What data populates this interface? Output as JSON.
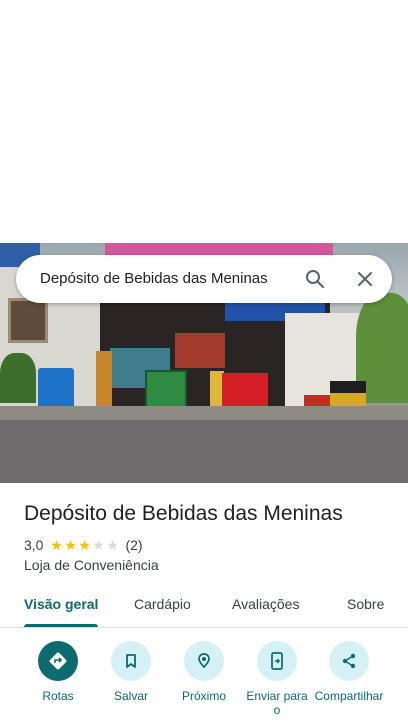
{
  "search": {
    "query": "Depósito de Bebidas das Meninas"
  },
  "place": {
    "title": "Depósito de Bebidas das Meninas",
    "rating": "3,0",
    "stars_filled": 3,
    "stars_total": 5,
    "review_count": "(2)",
    "category": "Loja de Conveniência"
  },
  "tabs": [
    {
      "label": "Visão geral",
      "active": true
    },
    {
      "label": "Cardápio",
      "active": false
    },
    {
      "label": "Avaliações",
      "active": false
    },
    {
      "label": "Sobre",
      "active": false
    }
  ],
  "actions": [
    {
      "label": "Rotas",
      "icon": "directions-icon"
    },
    {
      "label": "Salvar",
      "icon": "bookmark-icon"
    },
    {
      "label": "Próximo",
      "icon": "nearby-icon"
    },
    {
      "label": "Enviar para o",
      "icon": "send-to-phone-icon"
    },
    {
      "label": "Compartilhar",
      "icon": "share-icon"
    }
  ],
  "colors": {
    "accent": "#0b6b6f",
    "action_bg": "#d6f1f6",
    "star": "#fbbc04"
  }
}
